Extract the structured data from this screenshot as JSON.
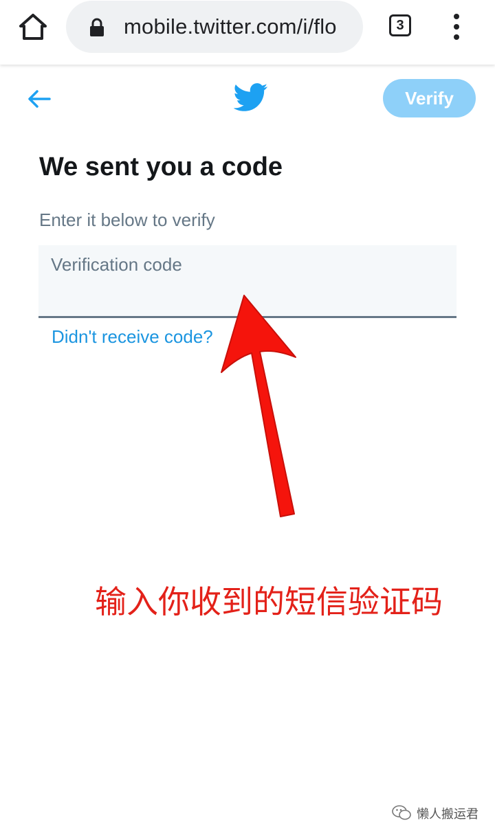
{
  "browser": {
    "url": "mobile.twitter.com/i/flo",
    "tab_count": "3",
    "home_icon": "home-icon",
    "lock_icon": "lock-icon",
    "menu_icon": "more-vert-icon"
  },
  "header": {
    "back_icon": "arrow-left-icon",
    "logo_icon": "twitter-bird-icon",
    "verify_label": "Verify"
  },
  "main": {
    "title": "We sent you a code",
    "subtitle": "Enter it below to verify",
    "code_input": {
      "placeholder": "Verification code",
      "value": ""
    },
    "resend_link": "Didn't receive code?"
  },
  "annotation": {
    "text": "输入你收到的短信验证码",
    "color": "#e32119"
  },
  "watermark": {
    "text": "懒人搬运君"
  },
  "colors": {
    "twitter_blue": "#1da1f2",
    "verify_disabled": "#8ed0f9",
    "link_blue": "#1b95e0",
    "text_primary": "#14171a",
    "text_secondary": "#657786",
    "field_bg": "#f5f8fa"
  }
}
